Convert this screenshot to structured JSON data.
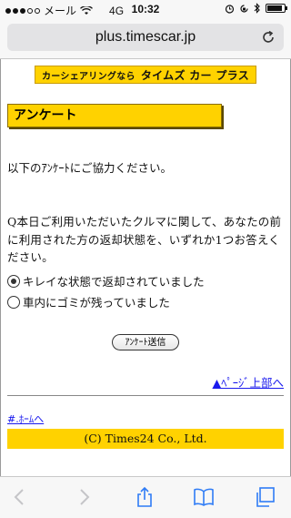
{
  "status_bar": {
    "carrier": "メール",
    "network": "4G",
    "time": "10:32"
  },
  "browser": {
    "url": "plus.timescar.jp"
  },
  "banner": {
    "prefix": "カーシェアリングなら",
    "brand": "タイムズ カー プラス"
  },
  "page": {
    "heading": "アンケート",
    "intro": "以下のｱﾝｹｰﾄにご協力ください。",
    "question": "Q本日ご利用いただいたクルマに関して、あなたの前に利用された方の返却状態を、いずれか1つお答えください。",
    "options": [
      {
        "label": "キレイな状態で返却されていました",
        "selected": true
      },
      {
        "label": "車内にゴミが残っていました",
        "selected": false
      }
    ],
    "submit_label": "ｱﾝｹｰﾄ送信",
    "top_link": "▲ﾍﾟｰｼﾞ上部へ",
    "home_link": "#.ﾎｰﾑへ",
    "copyright": "(C) Times24 Co., Ltd."
  },
  "colors": {
    "accent_yellow": "#ffd200",
    "link_blue": "#1a1aee",
    "ios_tint": "#2f7cf6"
  },
  "icons": [
    "back-arrow-icon",
    "forward-arrow-icon",
    "share-icon",
    "bookmarks-icon",
    "tabs-icon",
    "reload-icon",
    "alarm-icon",
    "orientation-lock-icon",
    "bluetooth-icon",
    "battery-icon"
  ]
}
